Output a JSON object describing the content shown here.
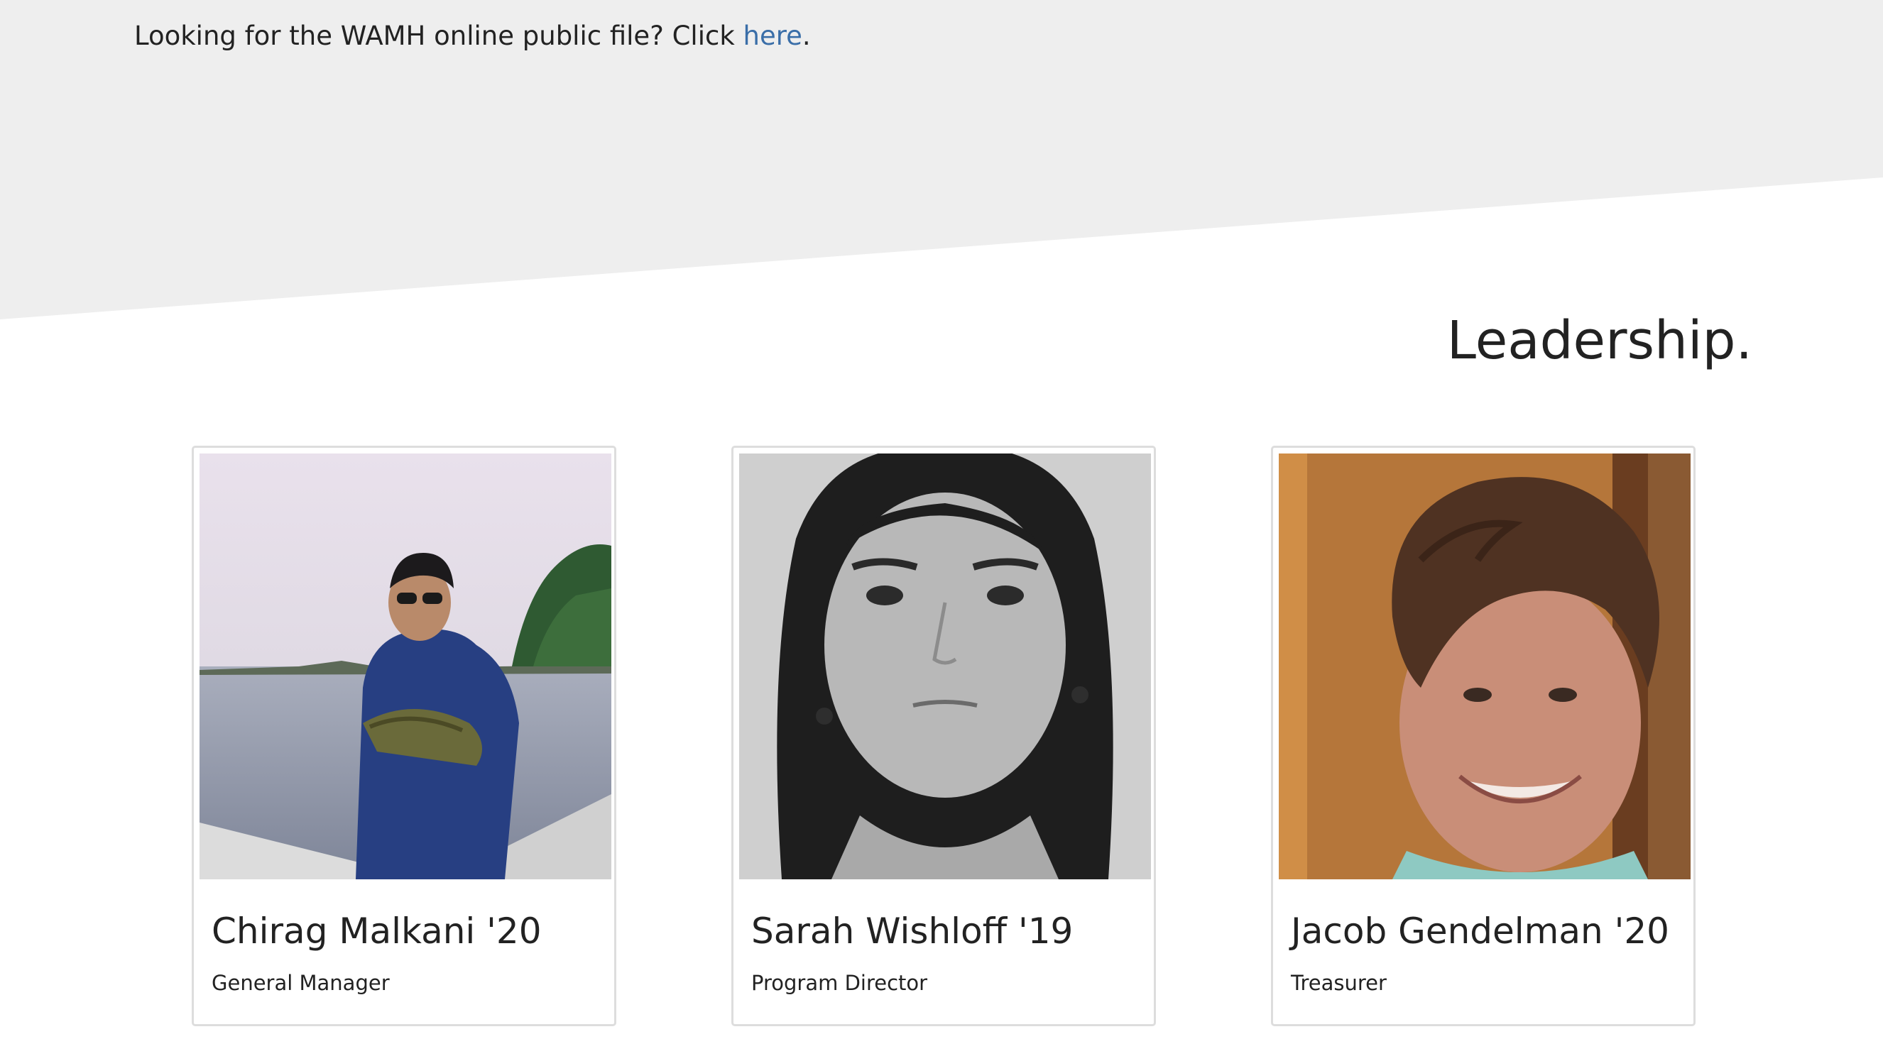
{
  "notice": {
    "prefix": "Looking for the WAMH online public file? Click ",
    "link_text": "here",
    "suffix": "."
  },
  "leadership": {
    "title": "Leadership.",
    "members": [
      {
        "name": "Chirag Malkani '20",
        "role": "General Manager",
        "photo": "photo-man-holding-fish-on-boat"
      },
      {
        "name": "Sarah Wishloff '19",
        "role": "Program Director",
        "photo": "photo-black-and-white-portrait"
      },
      {
        "name": "Jacob Gendelman '20",
        "role": "Treasurer",
        "photo": "photo-smiling-curly-hair-portrait"
      }
    ]
  },
  "colors": {
    "band": "#eeeeee",
    "link": "#3a6ea8",
    "card_border": "#dddddd"
  }
}
